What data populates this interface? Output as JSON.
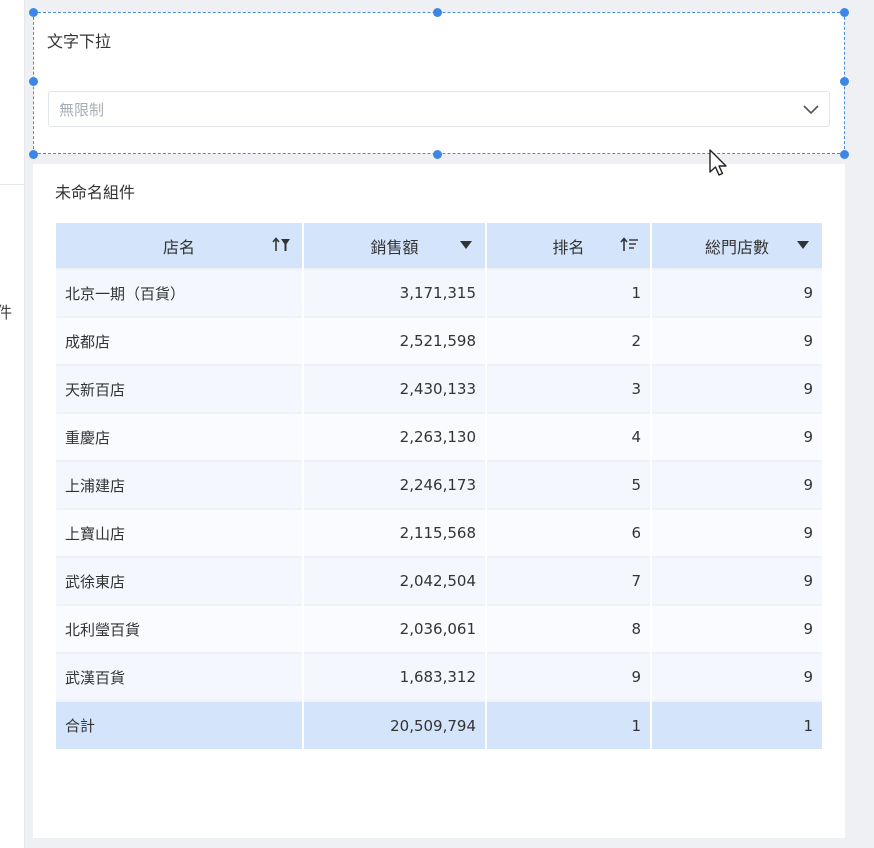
{
  "left_panel": {
    "cut_text": "件"
  },
  "filter": {
    "title": "文字下拉",
    "select_value": "無限制"
  },
  "table_widget": {
    "title": "未命名組件",
    "columns": [
      "店名",
      "銷售額",
      "排名",
      "総門店數"
    ],
    "rows": [
      [
        "北京一期（百貨）",
        "3,171,315",
        "1",
        "9"
      ],
      [
        "成都店",
        "2,521,598",
        "2",
        "9"
      ],
      [
        "天新百店",
        "2,430,133",
        "3",
        "9"
      ],
      [
        "重慶店",
        "2,263,130",
        "4",
        "9"
      ],
      [
        "上浦建店",
        "2,246,173",
        "5",
        "9"
      ],
      [
        "上寶山店",
        "2,115,568",
        "6",
        "9"
      ],
      [
        "武徐東店",
        "2,042,504",
        "7",
        "9"
      ],
      [
        "北利瑩百貨",
        "2,036,061",
        "8",
        "9"
      ],
      [
        "武漢百貨",
        "1,683,312",
        "9",
        "9"
      ]
    ],
    "total": [
      "合計",
      "20,509,794",
      "1",
      "1"
    ]
  },
  "icons": {
    "col0": "sort-filter-icon",
    "col1": "dropdown-triangle-icon",
    "col2": "sort-ascending-icon",
    "col3": "dropdown-triangle-icon"
  },
  "colors": {
    "header_bg": "#d4e5fb",
    "selection": "#3d86e6"
  }
}
